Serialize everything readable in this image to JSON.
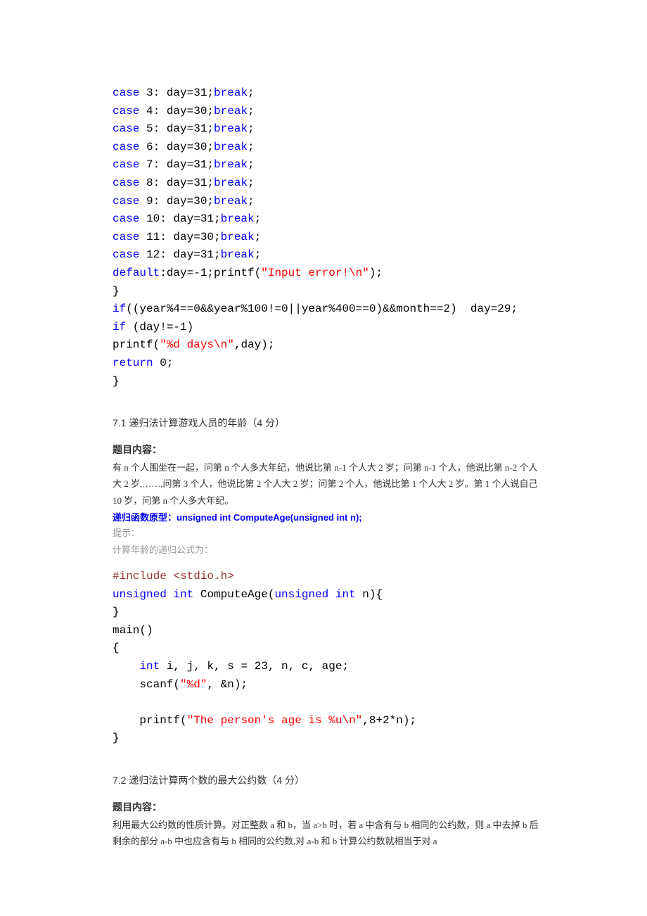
{
  "code1": {
    "l01_a": "case",
    "l01_b": " 3: day=31;",
    "l01_c": "break",
    "l01_d": ";",
    "l02_a": "case",
    "l02_b": " 4: day=30;",
    "l02_c": "break",
    "l02_d": ";",
    "l03_a": "case",
    "l03_b": " 5: day=31;",
    "l03_c": "break",
    "l03_d": ";",
    "l04_a": "case",
    "l04_b": " 6: day=30;",
    "l04_c": "break",
    "l04_d": ";",
    "l05_a": "case",
    "l05_b": " 7: day=31;",
    "l05_c": "break",
    "l05_d": ";",
    "l06_a": "case",
    "l06_b": " 8: day=31;",
    "l06_c": "break",
    "l06_d": ";",
    "l07_a": "case",
    "l07_b": " 9: day=30;",
    "l07_c": "break",
    "l07_d": ";",
    "l08_a": "case",
    "l08_b": " 10: day=31;",
    "l08_c": "break",
    "l08_d": ";",
    "l09_a": "case",
    "l09_b": " 11: day=30;",
    "l09_c": "break",
    "l09_d": ";",
    "l10_a": "case",
    "l10_b": " 12: day=31;",
    "l10_c": "break",
    "l10_d": ";",
    "l11_a": "default",
    "l11_b": ":day=-1;printf(",
    "l11_c": "\"Input error!\\n\"",
    "l11_d": ");",
    "l12": "}",
    "l13_a": "if",
    "l13_b": "((year%4==0&&year%100!=0||year%400==0)&&month==2)  day=29;",
    "l14_a": "if",
    "l14_b": " (day!=-1)",
    "l15_a": "printf(",
    "l15_b": "\"%d days\\n\"",
    "l15_c": ",day);",
    "l16_a": "return",
    "l16_b": " 0;",
    "l17": "}"
  },
  "sec71": {
    "heading": "7.1 递归法计算游戏人员的年龄（4 分）",
    "sub": "题目内容：",
    "body": "有 n 个人围坐在一起，问第 n 个人多大年纪，他说比第 n-1 个人大 2 岁；问第 n-1 个人，他说比第 n-2 个人大 2 岁,……,问第 3 个人，他说比第 2 个人大 2 岁；问第 2 个人，他说比第 1 个人大 2 岁。第 1 个人说自己 10 岁，问第 n 个人多大年纪。",
    "proto_label": "递归函数原型：",
    "proto_code": "unsigned int ComputeAge(unsigned int n);",
    "hint1": "提示：",
    "hint2": "计算年龄的递归公式为："
  },
  "code2": {
    "l01_a": "#include",
    "l01_b": " <stdio.h>",
    "l02_a": "unsigned",
    "l02_b": " ",
    "l02_c": "int",
    "l02_d": " ComputeAge(",
    "l02_e": "unsigned",
    "l02_f": " ",
    "l02_g": "int",
    "l02_h": " n){",
    "l03": "}",
    "l04": "main()",
    "l05": "{",
    "l06_a": "    ",
    "l06_b": "int",
    "l06_c": " i, j, k, s = 23, n, c, age;",
    "l07_a": "    scanf(",
    "l07_b": "\"%d\"",
    "l07_c": ", &n);",
    "l08": "",
    "l09_a": "    printf(",
    "l09_b": "\"The person's age is %u\\n\"",
    "l09_c": ",8+2*n);",
    "l10": "}"
  },
  "sec72": {
    "heading": "7.2 递归法计算两个数的最大公约数（4 分）",
    "sub": "题目内容：",
    "body": "利用最大公约数的性质计算。对正整数 a 和 b，当 a>b 时，若 a 中含有与 b 相同的公约数，则 a 中去掉 b 后剩余的部分 a-b 中也应含有与 b 相同的公约数,对 a-b 和 b 计算公约数就相当于对 a"
  }
}
